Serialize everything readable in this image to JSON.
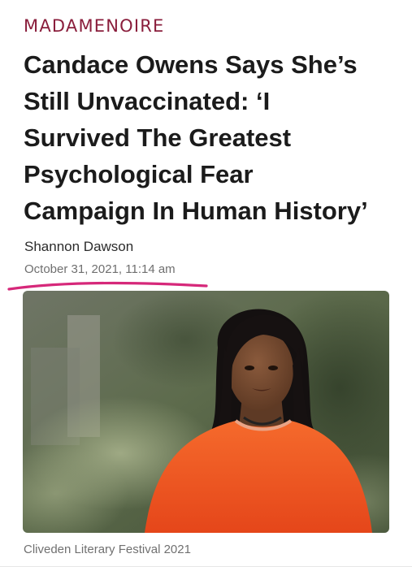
{
  "site": {
    "brand": "MADAMENOIRE",
    "brand_color": "#8a1e3c"
  },
  "article": {
    "headline_lines": [
      "Candace Owens Says She’s",
      "Still Unvaccinated: ‘I",
      "Survived The Greatest",
      "Psychological Fear",
      "Campaign In Human History’"
    ],
    "author": "Shannon Dawson",
    "published": "October 31, 2021, 11:14 am",
    "image_caption": "Cliveden Literary Festival 2021"
  },
  "annotation": {
    "underline_color": "#d6287a"
  },
  "colors": {
    "background": "#ffffff",
    "headline": "#1b1b1b",
    "sweater": "#f2541f"
  }
}
